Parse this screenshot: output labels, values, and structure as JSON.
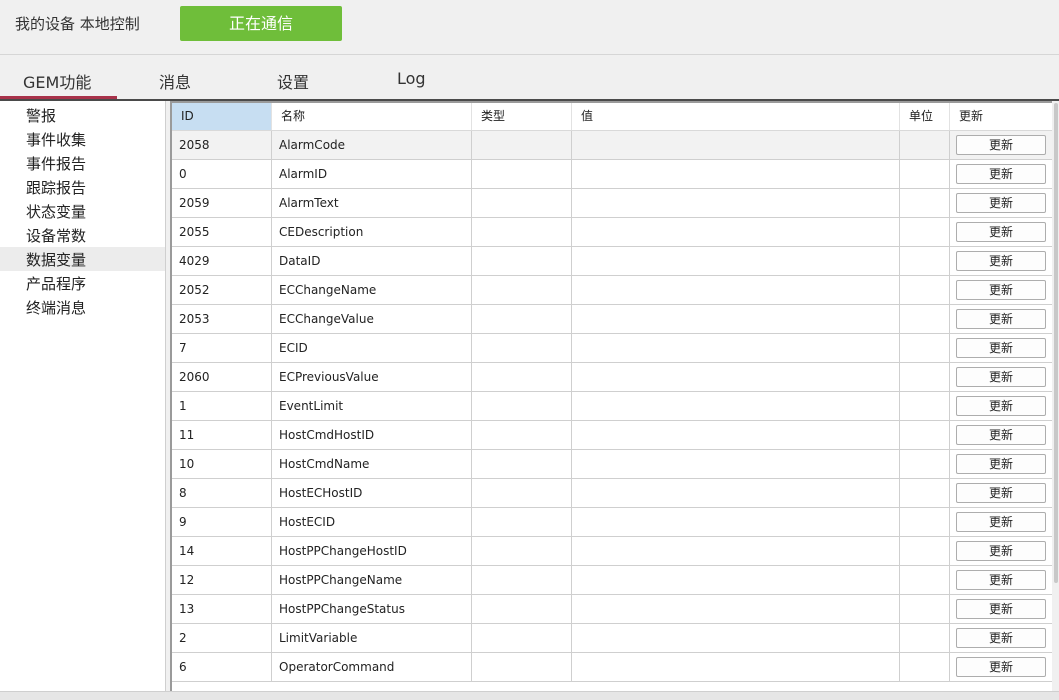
{
  "header": {
    "title": "我的设备 本地控制",
    "status_button": "正在通信",
    "status_color": "#6fbe3a"
  },
  "tabs": [
    {
      "label": "GEM功能",
      "active": true
    },
    {
      "label": "消息",
      "active": false
    },
    {
      "label": "设置",
      "active": false
    },
    {
      "label": "Log",
      "active": false
    }
  ],
  "sidebar": {
    "items": [
      {
        "label": "警报"
      },
      {
        "label": "事件收集"
      },
      {
        "label": "事件报告"
      },
      {
        "label": "跟踪报告"
      },
      {
        "label": "状态变量"
      },
      {
        "label": "设备常数"
      },
      {
        "label": "数据变量",
        "selected": true
      },
      {
        "label": "产品程序"
      },
      {
        "label": "终端消息"
      }
    ]
  },
  "table": {
    "columns": [
      "ID",
      "名称",
      "类型",
      "值",
      "单位",
      "更新"
    ],
    "update_label": "更新",
    "rows": [
      {
        "id": "2058",
        "name": "AlarmCode",
        "type": "",
        "value": "",
        "unit": ""
      },
      {
        "id": "0",
        "name": "AlarmID",
        "type": "",
        "value": "",
        "unit": ""
      },
      {
        "id": "2059",
        "name": "AlarmText",
        "type": "",
        "value": "",
        "unit": ""
      },
      {
        "id": "2055",
        "name": "CEDescription",
        "type": "",
        "value": "",
        "unit": ""
      },
      {
        "id": "4029",
        "name": "DataID",
        "type": "",
        "value": "",
        "unit": ""
      },
      {
        "id": "2052",
        "name": "ECChangeName",
        "type": "",
        "value": "",
        "unit": ""
      },
      {
        "id": "2053",
        "name": "ECChangeValue",
        "type": "",
        "value": "",
        "unit": ""
      },
      {
        "id": "7",
        "name": "ECID",
        "type": "",
        "value": "",
        "unit": ""
      },
      {
        "id": "2060",
        "name": "ECPreviousValue",
        "type": "",
        "value": "",
        "unit": ""
      },
      {
        "id": "1",
        "name": "EventLimit",
        "type": "",
        "value": "",
        "unit": ""
      },
      {
        "id": "11",
        "name": "HostCmdHostID",
        "type": "",
        "value": "",
        "unit": ""
      },
      {
        "id": "10",
        "name": "HostCmdName",
        "type": "",
        "value": "",
        "unit": ""
      },
      {
        "id": "8",
        "name": "HostECHostID",
        "type": "",
        "value": "",
        "unit": ""
      },
      {
        "id": "9",
        "name": "HostECID",
        "type": "",
        "value": "",
        "unit": ""
      },
      {
        "id": "14",
        "name": "HostPPChangeHostID",
        "type": "",
        "value": "",
        "unit": ""
      },
      {
        "id": "12",
        "name": "HostPPChangeName",
        "type": "",
        "value": "",
        "unit": ""
      },
      {
        "id": "13",
        "name": "HostPPChangeStatus",
        "type": "",
        "value": "",
        "unit": ""
      },
      {
        "id": "2",
        "name": "LimitVariable",
        "type": "",
        "value": "",
        "unit": ""
      },
      {
        "id": "6",
        "name": "OperatorCommand",
        "type": "",
        "value": "",
        "unit": ""
      }
    ]
  }
}
